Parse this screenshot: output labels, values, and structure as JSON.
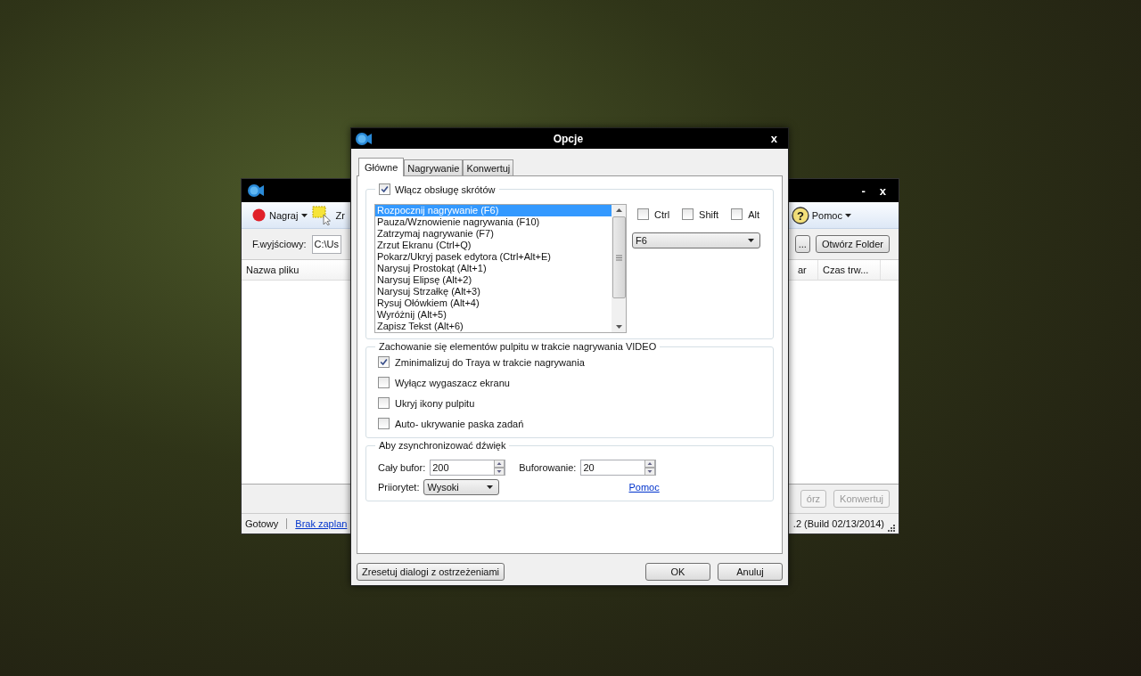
{
  "background_window": {
    "window_controls": [
      "-",
      "x"
    ],
    "toolbar": [
      {
        "kind": "record",
        "label": "Nagraj"
      },
      {
        "kind": "region",
        "label": "Zr"
      }
    ],
    "help_symbol": "?",
    "help_menu": "Pomoc",
    "output_label": "F.wyjściowy:",
    "output_value": "C:\\Us",
    "browse_button": "...",
    "open_folder_button": "Otwórz Folder",
    "columns": [
      "Nazwa pliku",
      "ar",
      "Czas trw..."
    ],
    "buttons": [
      {
        "label": "órz",
        "disabled": true
      },
      {
        "label": "Konwertuj",
        "disabled": true
      }
    ],
    "status": "Gotowy",
    "status_link": "Brak zaplan",
    "version": ".2 (Build 02/13/2014)"
  },
  "dialog": {
    "title": "Opcje",
    "close": "x",
    "tabs": [
      {
        "label": "Główne",
        "selected": true
      },
      {
        "label": "Nagrywanie",
        "selected": false
      },
      {
        "label": "Konwertuj",
        "selected": false
      }
    ],
    "hotkeys": {
      "enabled": true,
      "label": "Włącz obsługę skrótów",
      "actions": [
        {
          "label": "Rozpocznij nagrywanie (F6)",
          "selected": true
        },
        {
          "label": "Pauza/Wznowienie nagrywania (F10)",
          "selected": false
        },
        {
          "label": "Zatrzymaj nagrywanie (F7)",
          "selected": false
        },
        {
          "label": "Zrzut Ekranu (Ctrl+Q)",
          "selected": false
        },
        {
          "label": "Pokarz/Ukryj pasek edytora (Ctrl+Alt+E)",
          "selected": false
        },
        {
          "label": "Narysuj Prostokąt (Alt+1)",
          "selected": false
        },
        {
          "label": "Narysuj Elipsę (Alt+2)",
          "selected": false
        },
        {
          "label": "Narysuj Strzałkę (Alt+3)",
          "selected": false
        },
        {
          "label": "Rysuj Ołówkiem (Alt+4)",
          "selected": false
        },
        {
          "label": "Wyróżnij (Alt+5)",
          "selected": false
        },
        {
          "label": "Zapisz Tekst (Alt+6)",
          "selected": false
        }
      ],
      "modifiers": [
        {
          "label": "Ctrl",
          "checked": false
        },
        {
          "label": "Shift",
          "checked": false
        },
        {
          "label": "Alt",
          "checked": false
        }
      ],
      "key": "F6"
    },
    "desktop": {
      "title": "Zachowanie się elementów pulpitu w trakcie nagrywania VIDEO",
      "options": [
        {
          "label": "Zminimalizuj do Traya w trakcie nagrywania",
          "checked": true
        },
        {
          "label": "Wyłącz wygaszacz ekranu",
          "checked": false
        },
        {
          "label": "Ukryj ikony pulpitu",
          "checked": false
        },
        {
          "label": "Auto- ukrywanie paska zadań",
          "checked": false
        }
      ]
    },
    "sync": {
      "title": "Aby zsynchronizować dźwięk",
      "total_buffer_label": "Cały bufor:",
      "total_buffer": "200",
      "buffering_label": "Buforowanie:",
      "buffering": "20",
      "priority_label": "Priiorytet:",
      "priority": "Wysoki",
      "help_link": "Pomoc"
    },
    "buttons": [
      {
        "kind": "reset",
        "label": "Zresetuj dialogi z ostrzeżeniami"
      },
      {
        "kind": "ok",
        "label": "OK"
      },
      {
        "kind": "cancel",
        "label": "Anuluj"
      }
    ]
  }
}
